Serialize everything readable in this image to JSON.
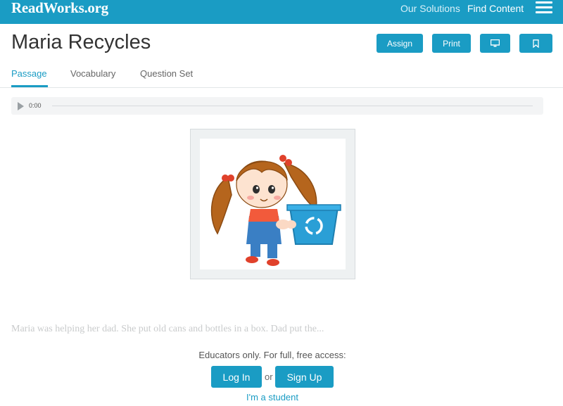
{
  "header": {
    "logo": "ReadWorks.org",
    "nav": {
      "our_solutions": "Our Solutions",
      "find_content": "Find Content"
    },
    "menu_icon": "hamburger-icon"
  },
  "article": {
    "title": "Maria Recycles",
    "actions": {
      "assign": "Assign",
      "print": "Print",
      "present_icon": "monitor-icon",
      "save_icon": "bookmark-icon"
    }
  },
  "tabs": [
    {
      "label": "Passage",
      "active": true
    },
    {
      "label": "Vocabulary",
      "active": false
    },
    {
      "label": "Question Set",
      "active": false
    }
  ],
  "audio": {
    "time": "0:00",
    "play_icon": "play-icon",
    "progress": 0
  },
  "passage": {
    "preview": "Maria was helping her dad. She put old cans and bottles in a box. Dad put the..."
  },
  "access": {
    "prompt": "Educators only. For full, free access:",
    "login": "Log In",
    "or": "or",
    "signup": "Sign Up",
    "student": "I'm a student"
  },
  "colors": {
    "brand": "#1a9cc4",
    "text": "#333333"
  }
}
